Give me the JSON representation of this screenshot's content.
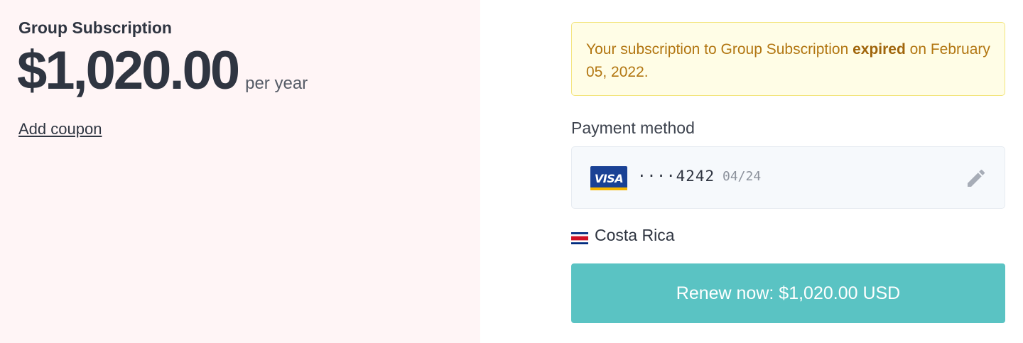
{
  "plan": {
    "name": "Group Subscription",
    "price": "$1,020.00",
    "period": "per year",
    "coupon_label": "Add coupon"
  },
  "alert": {
    "text_before": "Your subscription to Group Subscription ",
    "text_bold": "expired",
    "text_after": " on February 05, 2022."
  },
  "payment": {
    "label": "Payment method",
    "card_brand": "VISA",
    "card_number": "····4242",
    "card_expiry": "04/24",
    "edit_icon": "pencil-icon"
  },
  "country": {
    "name": "Costa Rica",
    "flag_icon": "costa-rica-flag-icon"
  },
  "renew_button": {
    "label": "Renew now: $1,020.00 USD"
  },
  "colors": {
    "left_background": "#fff5f6",
    "alert_background": "#fffde6",
    "alert_text": "#b27611",
    "button": "#5ac3c3",
    "visa_blue": "#1a4295"
  }
}
